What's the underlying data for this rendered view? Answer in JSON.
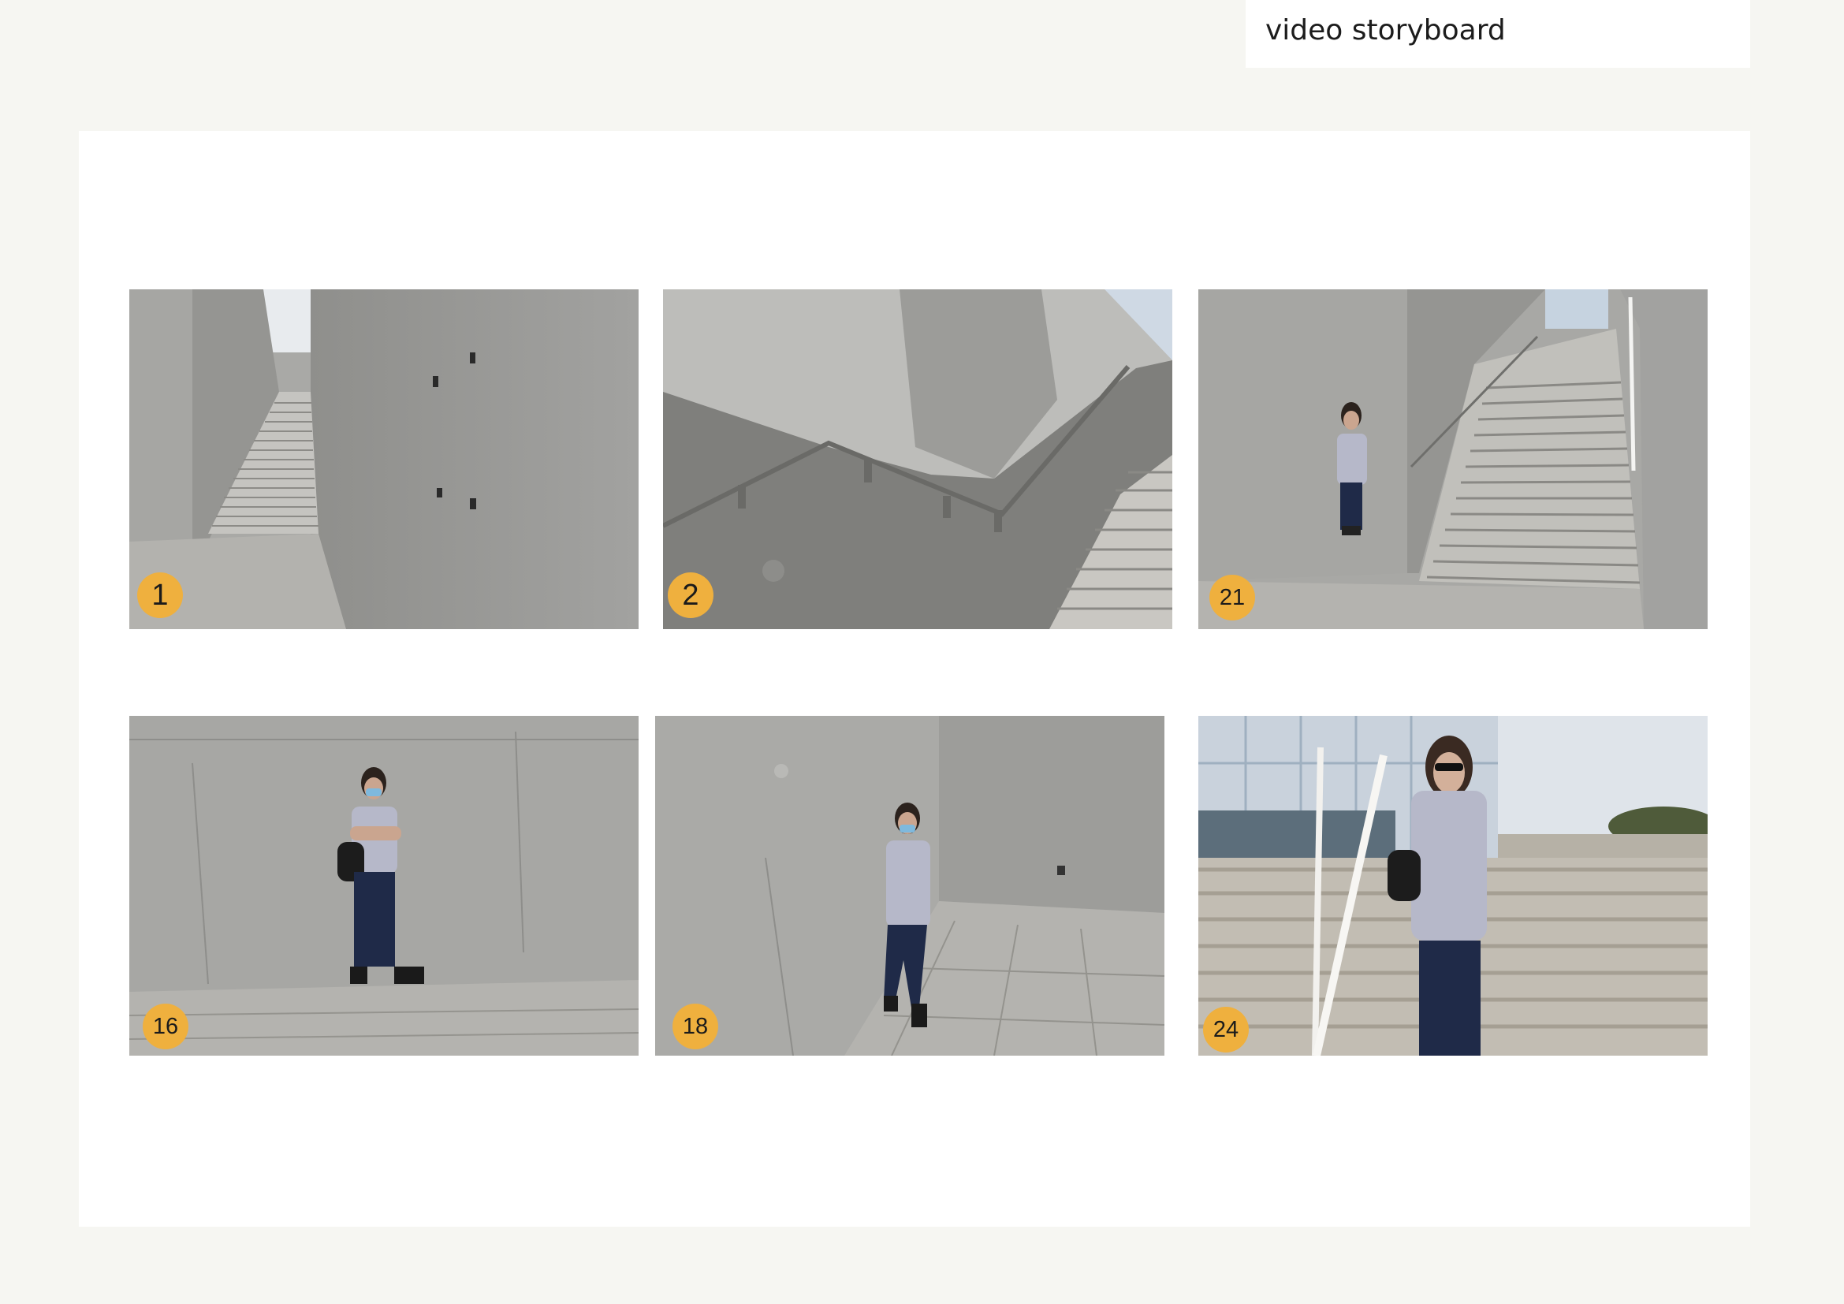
{
  "header": {
    "title": "video storyboard"
  },
  "frames": [
    {
      "number": "1",
      "scene": "empty staircase between concrete walls"
    },
    {
      "number": "2",
      "scene": "handrail shadow on concrete wall with steps"
    },
    {
      "number": "21",
      "scene": "woman leaning on wall beside staircase"
    },
    {
      "number": "16",
      "scene": "woman with face mask standing arms crossed against wall"
    },
    {
      "number": "18",
      "scene": "woman with face mask leaning on wall hand on hip"
    },
    {
      "number": "24",
      "scene": "woman in sunglasses walking down outdoor steps"
    }
  ],
  "colors": {
    "page_background": "#f6f6f2",
    "board_background": "#ffffff",
    "badge": "#efb03e",
    "concrete": "#a5a5a2"
  }
}
